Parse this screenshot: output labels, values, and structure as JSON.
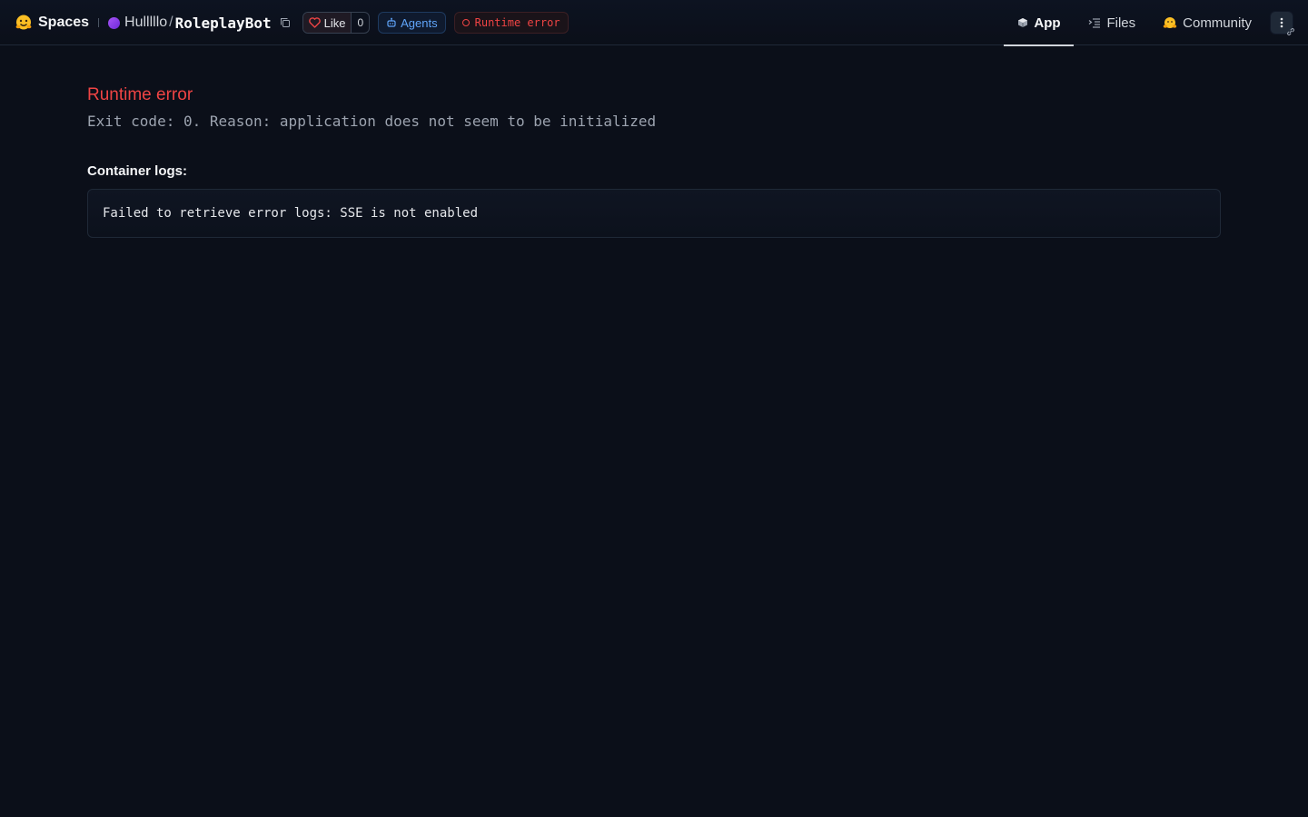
{
  "header": {
    "brand": "Spaces",
    "owner": "Hulllllo",
    "separator": "/",
    "repo": "RoleplayBot",
    "like_label": "Like",
    "like_count": "0",
    "agents_label": "Agents",
    "status_label": "Runtime error"
  },
  "tabs": {
    "app": "App",
    "files": "Files",
    "community": "Community"
  },
  "main": {
    "error_title": "Runtime error",
    "error_reason": "Exit code: 0. Reason: application does not seem to be initialized",
    "logs_heading": "Container logs:",
    "logs_text": "Failed to retrieve error logs: SSE is not enabled"
  },
  "colors": {
    "background": "#0b0f19",
    "error": "#ef4444",
    "agents": "#60a5fa"
  }
}
